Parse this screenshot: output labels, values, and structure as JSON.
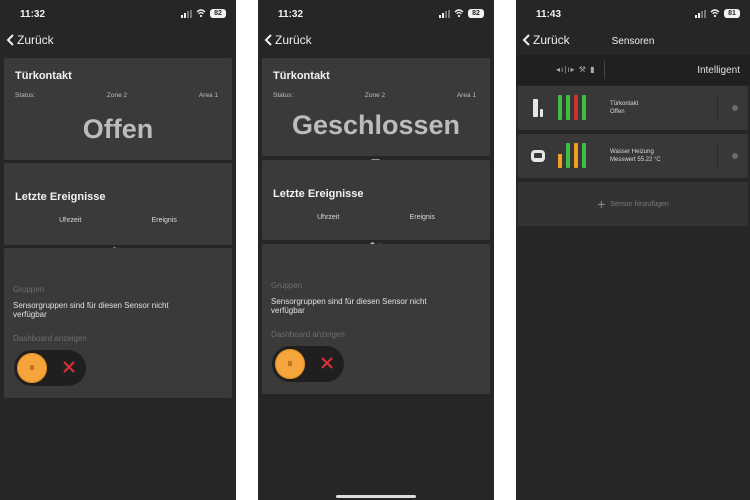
{
  "screen1": {
    "time": "11:32",
    "battery": "82",
    "back_label": "Zurück",
    "card1": {
      "title": "Türkontakt",
      "status_label": "Status:",
      "zone": "Zone 2",
      "area": "Area 1",
      "state": "Offen"
    },
    "card2": {
      "title": "Letzte Ereignisse",
      "col_time": "Uhrzeit",
      "col_event": "Ereignis"
    },
    "card3": {
      "groups_label": "Gruppen",
      "groups_text": "Sensorgruppen sind für diesen Sensor nicht verfügbar",
      "dashboard_label": "Dashboard anzeigen",
      "toggle_knob": "II"
    }
  },
  "screen2": {
    "time": "11:32",
    "battery": "82",
    "back_label": "Zurück",
    "card1": {
      "title": "Türkontakt",
      "status_label": "Status:",
      "zone": "Zone 2",
      "area": "Area 1",
      "state": "Geschlossen"
    },
    "card2": {
      "title": "Letzte Ereignisse",
      "col_time": "Uhrzeit",
      "col_event": "Ereignis"
    },
    "card3": {
      "groups_label": "Gruppen",
      "groups_text": "Sensorgruppen sind für diesen Sensor nicht verfügbar",
      "dashboard_label": "Dashboard anzeigen",
      "toggle_knob": "II"
    }
  },
  "screen3": {
    "time": "11:43",
    "battery": "81",
    "back_label": "Zurück",
    "title": "Sensoren",
    "header_icons": "◂ı|ı▸ ⚒ ▮",
    "mode": "Intelligent",
    "sensors": [
      {
        "name": "Türkontakt",
        "status": "Offen"
      },
      {
        "name": "Wasser Heizung",
        "status": "Messwert 55.22 °C"
      }
    ],
    "add_label": "Sensor hinzufügen"
  },
  "colors": {
    "accent_orange": "#f5a53c",
    "bar_green": "#3fbf3f",
    "bar_red": "#d23030",
    "bar_orange": "#f0a020",
    "x_red": "#e0303a"
  }
}
